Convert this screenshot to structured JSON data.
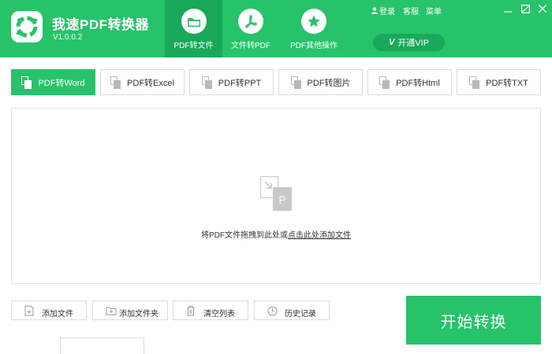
{
  "app": {
    "title": "我速PDF转换器",
    "version": "V1.0.0.2"
  },
  "nav_tabs": [
    {
      "label": "PDF转文件",
      "icon": "folder-icon",
      "active": true
    },
    {
      "label": "文件转PDF",
      "icon": "pdf-icon",
      "active": false
    },
    {
      "label": "PDF其他操作",
      "icon": "star-icon",
      "active": false
    }
  ],
  "top_links": {
    "login": "登录",
    "service": "客服",
    "menu": "菜单"
  },
  "vip": {
    "badge": "V",
    "label": "开通VIP"
  },
  "tool_tabs": [
    {
      "label": "PDF转Word",
      "active": true
    },
    {
      "label": "PDF转Excel",
      "active": false
    },
    {
      "label": "PDF转PPT",
      "active": false
    },
    {
      "label": "PDF转图片",
      "active": false
    },
    {
      "label": "PDF转Html",
      "active": false
    },
    {
      "label": "PDF转TXT",
      "active": false
    }
  ],
  "dropzone": {
    "text_before": "将PDF文件拖拽到此处或",
    "link_text": "点击此处添加文件",
    "icon_letter": "P"
  },
  "actions": [
    {
      "label": "添加文件",
      "icon": "add-file-icon"
    },
    {
      "label": "添加文件夹",
      "icon": "add-folder-icon"
    },
    {
      "label": "清空列表",
      "icon": "trash-icon"
    },
    {
      "label": "历史记录",
      "icon": "history-icon"
    }
  ],
  "start_button": "开始转换",
  "colors": {
    "brand_green": "#27c36b",
    "dark_green": "#1aa85a",
    "border": "#dcdcdc"
  }
}
